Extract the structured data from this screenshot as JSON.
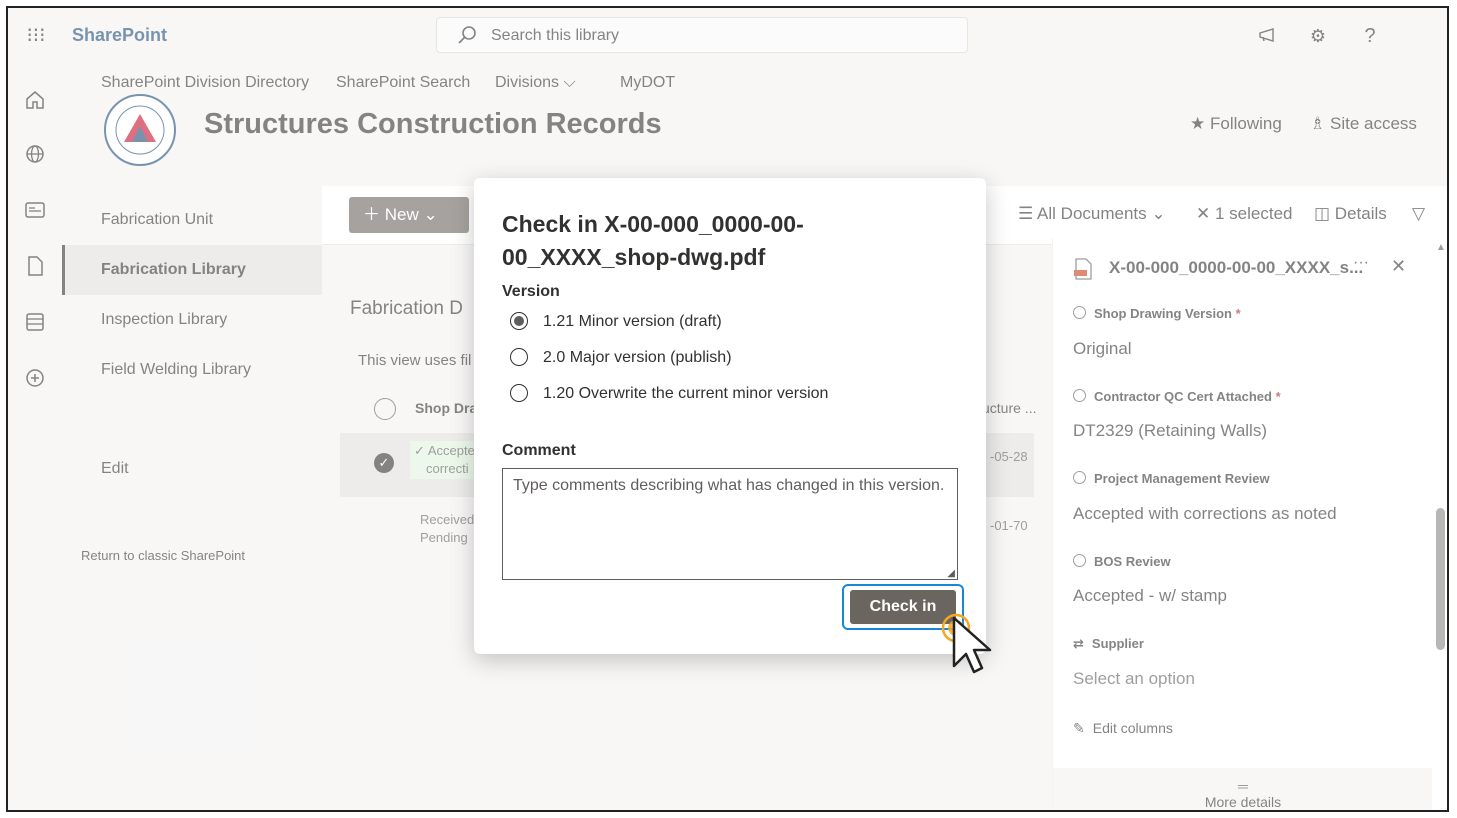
{
  "suite": {
    "app_name": "SharePoint",
    "search_placeholder": "Search this library"
  },
  "header": {
    "links": [
      "SharePoint Division Directory",
      "SharePoint Search",
      "Divisions",
      "MyDOT"
    ],
    "site_title": "Structures Construction Records",
    "following": "Following",
    "site_access": "Site access"
  },
  "leftnav": {
    "items": [
      "Fabrication Unit",
      "Fabrication Library",
      "Inspection Library",
      "Field Welding Library"
    ],
    "edit": "Edit",
    "return_classic": "Return to classic SharePoint"
  },
  "main": {
    "new_label": "New",
    "heading": "Fabrication D",
    "view_note": "This view uses fil",
    "col_header": "Shop Dra",
    "col_right": "ucture ...",
    "row1_status_line1": "Accepte",
    "row1_status_line2": "correcti",
    "row1_right": "-05-28",
    "row2_status_line1": "Received -",
    "row2_status_line2": "Pending",
    "row2_right": "-01-70"
  },
  "toolbar": {
    "view": "All Documents",
    "selected": "1 selected",
    "details": "Details"
  },
  "details": {
    "file_title": "X-00-000_0000-00-00_XXXX_s...",
    "fields": [
      {
        "label": "Shop Drawing Version",
        "required": "*",
        "value": "Original"
      },
      {
        "label": "Contractor QC Cert Attached",
        "required": "*",
        "value": "DT2329 (Retaining Walls)"
      },
      {
        "label": "Project Management Review",
        "required": "",
        "value": "Accepted with corrections as noted"
      },
      {
        "label": "BOS Review",
        "required": "",
        "value": "Accepted - w/ stamp"
      },
      {
        "label": "Supplier",
        "required": "",
        "value": "Select an option"
      }
    ],
    "edit_columns": "Edit columns",
    "more_details": "More details"
  },
  "dialog": {
    "title": "Check in X-00-000_0000-00-00_XXXX_shop-dwg.pdf",
    "version_label": "Version",
    "options": [
      "1.21 Minor version (draft)",
      "2.0 Major version (publish)",
      "1.20 Overwrite the current minor version"
    ],
    "selected_option": 0,
    "comment_label": "Comment",
    "comment_placeholder": "Type comments describing what has changed in this version.",
    "check_in_button": "Check in"
  },
  "colors": {
    "brand": "#1e4b7a",
    "button": "#6b6560",
    "focus_ring": "#1a86d8",
    "cursor_highlight": "#f5a623"
  }
}
